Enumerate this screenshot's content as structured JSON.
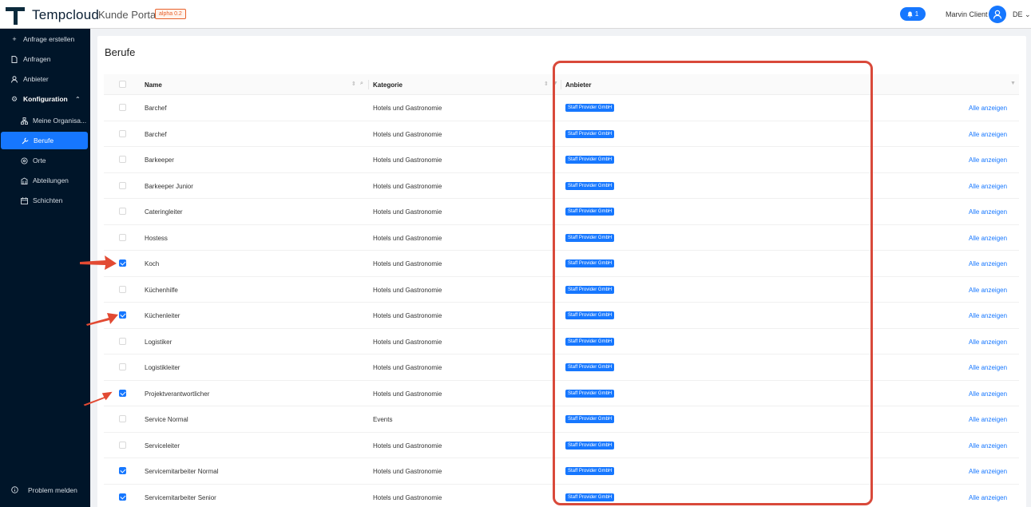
{
  "header": {
    "brand": "Tempcloud",
    "portal": "Kunde Portal",
    "badge": "alpha 0.2",
    "notification_count": "1",
    "user_name": "Marvin Client",
    "language": "DE"
  },
  "sidebar": {
    "items": [
      {
        "label": "Anfrage erstellen",
        "icon": "plus-icon"
      },
      {
        "label": "Anfragen",
        "icon": "document-icon"
      },
      {
        "label": "Anbieter",
        "icon": "user-icon"
      },
      {
        "label": "Konfiguration",
        "icon": "gear-icon"
      },
      {
        "label": "Meine Organisa...",
        "icon": "org-icon"
      },
      {
        "label": "Berufe",
        "icon": "wrench-icon"
      },
      {
        "label": "Orte",
        "icon": "location-icon"
      },
      {
        "label": "Abteilungen",
        "icon": "building-icon"
      },
      {
        "label": "Schichten",
        "icon": "calendar-icon"
      }
    ],
    "footer_label": "Problem melden"
  },
  "page": {
    "title": "Berufe"
  },
  "table": {
    "columns": [
      "Name",
      "Kategorie",
      "Anbieter"
    ],
    "rows": [
      {
        "name": "Barchef",
        "category": "Hotels und Gastronomie",
        "provider": "Staff Provider GmbH",
        "action": "Alle anzeigen",
        "checked": false
      },
      {
        "name": "Barchef",
        "category": "Hotels und Gastronomie",
        "provider": "Staff Provider GmbH",
        "action": "Alle anzeigen",
        "checked": false
      },
      {
        "name": "Barkeeper",
        "category": "Hotels und Gastronomie",
        "provider": "Staff Provider GmbH",
        "action": "Alle anzeigen",
        "checked": false
      },
      {
        "name": "Barkeeper Junior",
        "category": "Hotels und Gastronomie",
        "provider": "Staff Provider GmbH",
        "action": "Alle anzeigen",
        "checked": false
      },
      {
        "name": "Cateringleiter",
        "category": "Hotels und Gastronomie",
        "provider": "Staff Provider GmbH",
        "action": "Alle anzeigen",
        "checked": false
      },
      {
        "name": "Hostess",
        "category": "Hotels und Gastronomie",
        "provider": "Staff Provider GmbH",
        "action": "Alle anzeigen",
        "checked": false
      },
      {
        "name": "Koch",
        "category": "Hotels und Gastronomie",
        "provider": "Staff Provider GmbH",
        "action": "Alle anzeigen",
        "checked": true
      },
      {
        "name": "Küchenhilfe",
        "category": "Hotels und Gastronomie",
        "provider": "Staff Provider GmbH",
        "action": "Alle anzeigen",
        "checked": false
      },
      {
        "name": "Küchenleiter",
        "category": "Hotels und Gastronomie",
        "provider": "Staff Provider GmbH",
        "action": "Alle anzeigen",
        "checked": true
      },
      {
        "name": "Logistiker",
        "category": "Hotels und Gastronomie",
        "provider": "Staff Provider GmbH",
        "action": "Alle anzeigen",
        "checked": false
      },
      {
        "name": "Logistikleiter",
        "category": "Hotels und Gastronomie",
        "provider": "Staff Provider GmbH",
        "action": "Alle anzeigen",
        "checked": false
      },
      {
        "name": "Projektverantwortlicher",
        "category": "Hotels und Gastronomie",
        "provider": "Staff Provider GmbH",
        "action": "Alle anzeigen",
        "checked": true
      },
      {
        "name": "Service Normal",
        "category": "Events",
        "provider": "Staff Provider GmbH",
        "action": "Alle anzeigen",
        "checked": false
      },
      {
        "name": "Serviceleiter",
        "category": "Hotels und Gastronomie",
        "provider": "Staff Provider GmbH",
        "action": "Alle anzeigen",
        "checked": false
      },
      {
        "name": "Servicemitarbeiter Normal",
        "category": "Hotels und Gastronomie",
        "provider": "Staff Provider GmbH",
        "action": "Alle anzeigen",
        "checked": true
      },
      {
        "name": "Servicemitarbeiter Senior",
        "category": "Hotels und Gastronomie",
        "provider": "Staff Provider GmbH",
        "action": "Alle anzeigen",
        "checked": true
      }
    ]
  },
  "colors": {
    "primary": "#1677ff",
    "sidebar": "#001529",
    "annotation": "#d9493a"
  }
}
